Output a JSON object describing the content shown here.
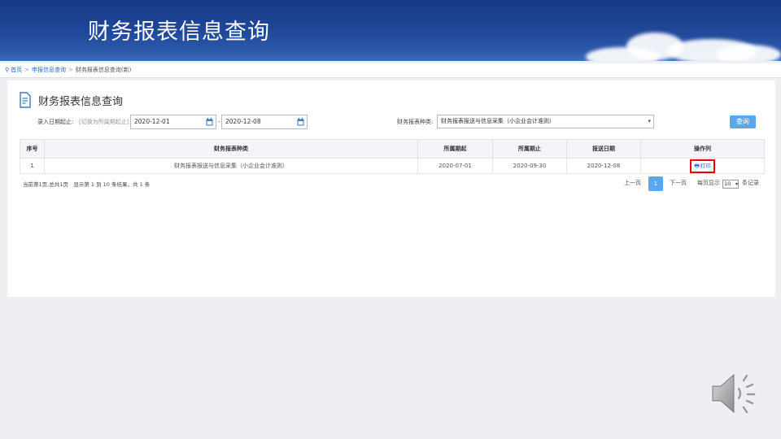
{
  "banner": {
    "title": "财务报表信息查询"
  },
  "breadcrumb": {
    "home": "首页",
    "sep": ">",
    "level1": "申报信息查询",
    "current": "财务报表信息查询(新)"
  },
  "panel": {
    "title": "财务报表信息查询",
    "date_label": "录入日期起止:",
    "date_hint": "[切换为所属期起止]",
    "date_from": "2020-12-01",
    "date_sep": "-",
    "date_to": "2020-12-08",
    "type_label": "财务报表种类:",
    "type_value": "财务报表报送与信息采集（小企业会计准则）",
    "query_button": "查询"
  },
  "table": {
    "headers": [
      "序号",
      "财务报表种类",
      "所属期起",
      "所属期止",
      "报送日期",
      "操作列"
    ],
    "rows": [
      {
        "no": "1",
        "type": "财务报表报送与信息采集（小企业会计准则）",
        "start": "2020-07-01",
        "end": "2020-09-30",
        "submit": "2020-12-08",
        "action": "打印"
      }
    ]
  },
  "pagination": {
    "summary": "当前第1页,总共1页　显示第 1 到 10 条结果，共 1 条",
    "prev": "上一页",
    "current": "1",
    "next": "下一页",
    "per_page_label": "每页显示",
    "per_page_value": "10",
    "per_page_suffix": "条记录"
  },
  "colors": {
    "accent": "#5ba7ee",
    "highlight_box": "#ee0000",
    "banner": "#1f4596"
  },
  "icons": [
    "location-pin-icon",
    "report-document-icon",
    "calendar-icon",
    "dropdown-caret-icon",
    "printer-icon",
    "speaker-icon"
  ]
}
